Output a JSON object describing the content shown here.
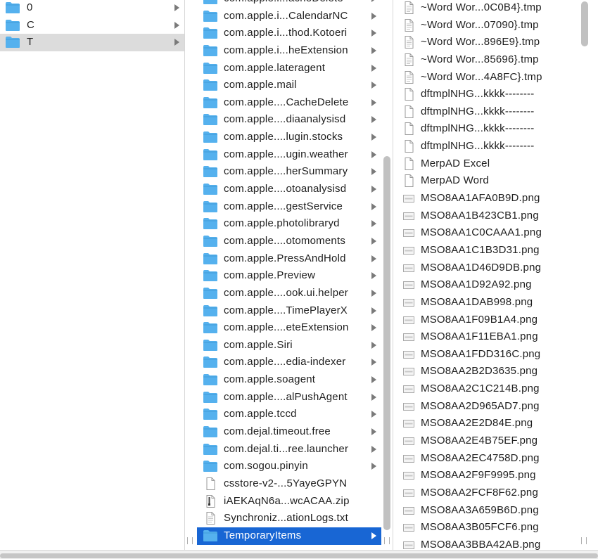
{
  "column1": {
    "items": [
      {
        "label": "0",
        "icon": "folder-icon",
        "state": "normal"
      },
      {
        "label": "C",
        "icon": "folder-icon",
        "state": "normal"
      },
      {
        "label": "T",
        "icon": "folder-icon",
        "state": "selected-inactive"
      }
    ]
  },
  "column2": {
    "items": [
      {
        "label": "com.apple.i...acheDelete",
        "icon": "folder-icon",
        "state": "normal"
      },
      {
        "label": "com.apple.i...CalendarNC",
        "icon": "folder-icon",
        "state": "normal"
      },
      {
        "label": "com.apple.i...thod.Kotoeri",
        "icon": "folder-icon",
        "state": "normal"
      },
      {
        "label": "com.apple.i...heExtension",
        "icon": "folder-icon",
        "state": "normal"
      },
      {
        "label": "com.apple.lateragent",
        "icon": "folder-icon",
        "state": "normal"
      },
      {
        "label": "com.apple.mail",
        "icon": "folder-icon",
        "state": "normal"
      },
      {
        "label": "com.apple....CacheDelete",
        "icon": "folder-icon",
        "state": "normal"
      },
      {
        "label": "com.apple....diaanalysisd",
        "icon": "folder-icon",
        "state": "normal"
      },
      {
        "label": "com.apple....lugin.stocks",
        "icon": "folder-icon",
        "state": "normal"
      },
      {
        "label": "com.apple....ugin.weather",
        "icon": "folder-icon",
        "state": "normal"
      },
      {
        "label": "com.apple....herSummary",
        "icon": "folder-icon",
        "state": "normal"
      },
      {
        "label": "com.apple....otoanalysisd",
        "icon": "folder-icon",
        "state": "normal"
      },
      {
        "label": "com.apple....gestService",
        "icon": "folder-icon",
        "state": "normal"
      },
      {
        "label": "com.apple.photolibraryd",
        "icon": "folder-icon",
        "state": "normal"
      },
      {
        "label": "com.apple....otomoments",
        "icon": "folder-icon",
        "state": "normal"
      },
      {
        "label": "com.apple.PressAndHold",
        "icon": "folder-icon",
        "state": "normal"
      },
      {
        "label": "com.apple.Preview",
        "icon": "folder-icon",
        "state": "normal"
      },
      {
        "label": "com.apple....ook.ui.helper",
        "icon": "folder-icon",
        "state": "normal"
      },
      {
        "label": "com.apple....TimePlayerX",
        "icon": "folder-icon",
        "state": "normal"
      },
      {
        "label": "com.apple....eteExtension",
        "icon": "folder-icon",
        "state": "normal"
      },
      {
        "label": "com.apple.Siri",
        "icon": "folder-icon",
        "state": "normal"
      },
      {
        "label": "com.apple....edia-indexer",
        "icon": "folder-icon",
        "state": "normal"
      },
      {
        "label": "com.apple.soagent",
        "icon": "folder-icon",
        "state": "normal"
      },
      {
        "label": "com.apple....alPushAgent",
        "icon": "folder-icon",
        "state": "normal"
      },
      {
        "label": "com.apple.tccd",
        "icon": "folder-icon",
        "state": "normal"
      },
      {
        "label": "com.dejal.timeout.free",
        "icon": "folder-icon",
        "state": "normal"
      },
      {
        "label": "com.dejal.ti...ree.launcher",
        "icon": "folder-icon",
        "state": "normal"
      },
      {
        "label": "com.sogou.pinyin",
        "icon": "folder-icon",
        "state": "normal"
      },
      {
        "label": "csstore-v2-...5YayeGPYN",
        "icon": "document-icon",
        "state": "normal"
      },
      {
        "label": "iAEKAqN6a...wcACAA.zip",
        "icon": "zip-archive-icon",
        "state": "normal"
      },
      {
        "label": "Synchroniz...ationLogs.txt",
        "icon": "text-file-icon",
        "state": "normal"
      },
      {
        "label": "TemporaryItems",
        "icon": "folder-icon",
        "state": "selected-active"
      }
    ]
  },
  "column3": {
    "items": [
      {
        "label": "~Word Wor...0C0B4}.tmp",
        "icon": "text-file-icon"
      },
      {
        "label": "~Word Wor...07090}.tmp",
        "icon": "text-file-icon"
      },
      {
        "label": "~Word Wor...896E9}.tmp",
        "icon": "text-file-icon"
      },
      {
        "label": "~Word Wor...85696}.tmp",
        "icon": "text-file-icon"
      },
      {
        "label": "~Word Wor...4A8FC}.tmp",
        "icon": "text-file-icon"
      },
      {
        "label": "dftmplNHG...kkkk--------",
        "icon": "document-icon"
      },
      {
        "label": "dftmplNHG...kkkk--------",
        "icon": "document-icon"
      },
      {
        "label": "dftmplNHG...kkkk--------",
        "icon": "document-icon"
      },
      {
        "label": "dftmplNHG...kkkk--------",
        "icon": "document-icon"
      },
      {
        "label": "MerpAD Excel",
        "icon": "document-icon"
      },
      {
        "label": "MerpAD Word",
        "icon": "document-icon"
      },
      {
        "label": "MSO8AA1AFA0B9D.png",
        "icon": "image-thumbnail-icon"
      },
      {
        "label": "MSO8AA1B423CB1.png",
        "icon": "image-thumbnail-icon"
      },
      {
        "label": "MSO8AA1C0CAAA1.png",
        "icon": "image-thumbnail-icon"
      },
      {
        "label": "MSO8AA1C1B3D31.png",
        "icon": "image-thumbnail-icon"
      },
      {
        "label": "MSO8AA1D46D9DB.png",
        "icon": "image-thumbnail-icon"
      },
      {
        "label": "MSO8AA1D92A92.png",
        "icon": "image-thumbnail-icon"
      },
      {
        "label": "MSO8AA1DAB998.png",
        "icon": "image-thumbnail-icon"
      },
      {
        "label": "MSO8AA1F09B1A4.png",
        "icon": "image-thumbnail-icon"
      },
      {
        "label": "MSO8AA1F11EBA1.png",
        "icon": "image-thumbnail-icon"
      },
      {
        "label": "MSO8AA1FDD316C.png",
        "icon": "image-thumbnail-icon"
      },
      {
        "label": "MSO8AA2B2D3635.png",
        "icon": "image-thumbnail-icon"
      },
      {
        "label": "MSO8AA2C1C214B.png",
        "icon": "image-thumbnail-icon"
      },
      {
        "label": "MSO8AA2D965AD7.png",
        "icon": "image-thumbnail-icon"
      },
      {
        "label": "MSO8AA2E2D84E.png",
        "icon": "image-thumbnail-icon"
      },
      {
        "label": "MSO8AA2E4B75EF.png",
        "icon": "image-thumbnail-icon"
      },
      {
        "label": "MSO8AA2EC4758D.png",
        "icon": "image-thumbnail-icon"
      },
      {
        "label": "MSO8AA2F9F9995.png",
        "icon": "image-thumbnail-icon"
      },
      {
        "label": "MSO8AA2FCF8F62.png",
        "icon": "image-thumbnail-icon"
      },
      {
        "label": "MSO8AA3A659B6D.png",
        "icon": "image-thumbnail-icon"
      },
      {
        "label": "MSO8AA3B05FCF6.png",
        "icon": "image-thumbnail-icon"
      },
      {
        "label": "MSO8AA3BBA42AB.png",
        "icon": "image-thumbnail-icon"
      }
    ]
  },
  "colors": {
    "folder": "#55b1ee",
    "selection_active": "#1866d4",
    "selection_inactive": "#dcdcdc"
  }
}
